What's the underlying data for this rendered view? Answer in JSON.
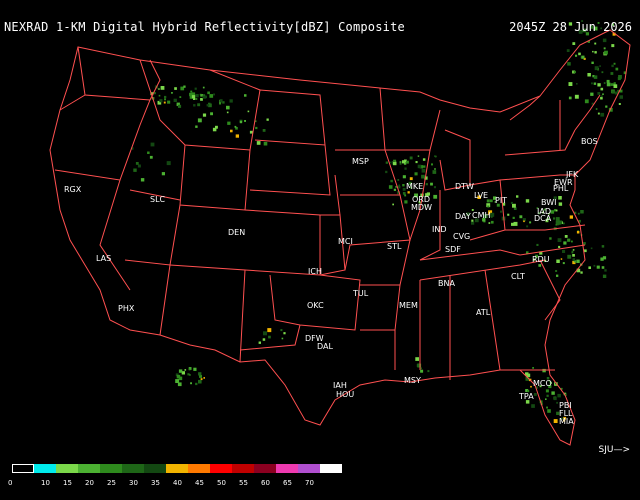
{
  "header": {
    "title": "NEXRAD 1-KM Digital Hybrid Reflectivity[dBZ] Composite",
    "timestamp": "2045Z 28 Jun 2026"
  },
  "colors": {
    "border": "#ff5050",
    "background": "#000000",
    "text": "#ffffff"
  },
  "cities": [
    {
      "code": "MSP"
    },
    {
      "code": "MKE"
    },
    {
      "code": "ORD"
    },
    {
      "code": "MDW"
    },
    {
      "code": "DTW"
    },
    {
      "code": "LVE"
    },
    {
      "code": "PIT"
    },
    {
      "code": "DAY"
    },
    {
      "code": "CMH"
    },
    {
      "code": "IND"
    },
    {
      "code": "CVG"
    },
    {
      "code": "SDF"
    },
    {
      "code": "STL"
    },
    {
      "code": "MCI"
    },
    {
      "code": "DEN"
    },
    {
      "code": "SLC"
    },
    {
      "code": "RGX"
    },
    {
      "code": "LAS"
    },
    {
      "code": "PHX"
    },
    {
      "code": "ICH"
    },
    {
      "code": "TUL"
    },
    {
      "code": "OKC"
    },
    {
      "code": "DFW"
    },
    {
      "code": "DAL"
    },
    {
      "code": "IAH"
    },
    {
      "code": "HOU"
    },
    {
      "code": "MSY"
    },
    {
      "code": "MEM"
    },
    {
      "code": "BNA"
    },
    {
      "code": "ATL"
    },
    {
      "code": "CLT"
    },
    {
      "code": "RDU"
    },
    {
      "code": "BOS"
    },
    {
      "code": "JFK"
    },
    {
      "code": "EWR"
    },
    {
      "code": "PHL"
    },
    {
      "code": "BWI"
    },
    {
      "code": "IAD"
    },
    {
      "code": "DCA"
    },
    {
      "code": "MCO"
    },
    {
      "code": "TPA"
    },
    {
      "code": "PBI"
    },
    {
      "code": "FLL"
    },
    {
      "code": "MIA"
    }
  ],
  "legend": {
    "labels": [
      "0",
      "10",
      "15",
      "20",
      "25",
      "30",
      "35",
      "40",
      "45",
      "50",
      "55",
      "60",
      "65",
      "70"
    ],
    "swatches": [
      {
        "color": "#000000"
      },
      {
        "color": "#00ebec"
      },
      {
        "color": "#7bd84a"
      },
      {
        "color": "#4cb132"
      },
      {
        "color": "#2e8a1d"
      },
      {
        "color": "#1e6617"
      },
      {
        "color": "#134812"
      },
      {
        "color": "#f2b400"
      },
      {
        "color": "#ff7a00"
      },
      {
        "color": "#ff0000"
      },
      {
        "color": "#c00000"
      },
      {
        "color": "#8b0020"
      },
      {
        "color": "#ee3ab0"
      },
      {
        "color": "#b04fcf"
      },
      {
        "color": "#ffffff"
      }
    ]
  },
  "scroll_hint": "SJU—>"
}
